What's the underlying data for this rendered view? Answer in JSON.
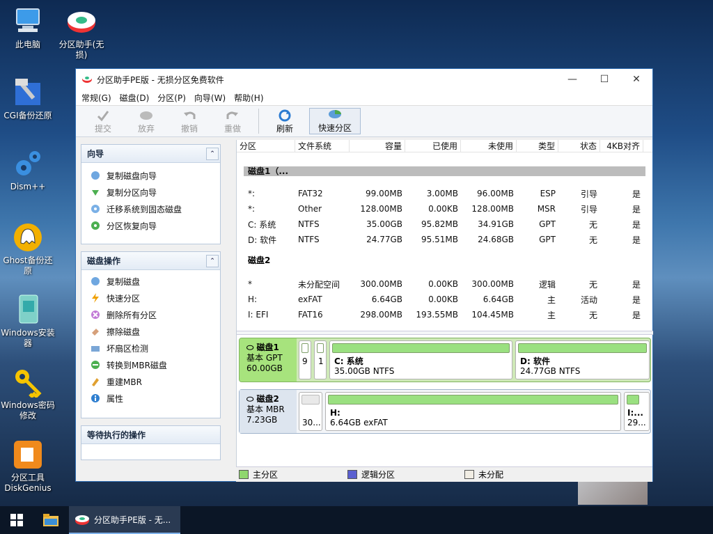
{
  "desktop": {
    "icons": [
      {
        "label": "此电脑"
      },
      {
        "label": "分区助手(无损)"
      },
      {
        "label": "CGI备份还原"
      },
      {
        "label": "Dism++"
      },
      {
        "label": "Ghost备份还原"
      },
      {
        "label": "Windows安装器"
      },
      {
        "label": "Windows密码修改"
      },
      {
        "label": "分区工具DiskGenius"
      }
    ]
  },
  "taskbar": {
    "task_label": "分区助手PE版 - 无..."
  },
  "window": {
    "title": "分区助手PE版 - 无损分区免费软件",
    "minimize": "—",
    "maximize": "☐",
    "close": "✕",
    "menu": [
      "常规(G)",
      "磁盘(D)",
      "分区(P)",
      "向导(W)",
      "帮助(H)"
    ],
    "toolbar": {
      "commit": "提交",
      "discard": "放弃",
      "undo": "撤销",
      "redo": "重做",
      "refresh": "刷新",
      "quick_partition": "快速分区"
    }
  },
  "sidebar": {
    "wizard_title": "向导",
    "wizard_items": [
      "复制磁盘向导",
      "复制分区向导",
      "迁移系统到固态磁盘",
      "分区恢复向导"
    ],
    "diskops_title": "磁盘操作",
    "diskops_items": [
      "复制磁盘",
      "快速分区",
      "删除所有分区",
      "擦除磁盘",
      "坏扇区检测",
      "转换到MBR磁盘",
      "重建MBR",
      "属性"
    ],
    "pending_title": "等待执行的操作"
  },
  "table": {
    "columns": [
      "分区",
      "文件系统",
      "容量",
      "已使用",
      "未使用",
      "类型",
      "状态",
      "4KB对齐"
    ],
    "disk1_label": "磁盘1（...",
    "disk1_rows": [
      {
        "part": "*:",
        "fs": "FAT32",
        "size": "99.00MB",
        "used": "3.00MB",
        "free": "96.00MB",
        "type": "ESP",
        "status": "引导",
        "align": "是"
      },
      {
        "part": "*:",
        "fs": "Other",
        "size": "128.00MB",
        "used": "0.00KB",
        "free": "128.00MB",
        "type": "MSR",
        "status": "引导",
        "align": "是"
      },
      {
        "part": "C: 系统",
        "fs": "NTFS",
        "size": "35.00GB",
        "used": "95.82MB",
        "free": "34.91GB",
        "type": "GPT",
        "status": "无",
        "align": "是"
      },
      {
        "part": "D: 软件",
        "fs": "NTFS",
        "size": "24.77GB",
        "used": "95.51MB",
        "free": "24.68GB",
        "type": "GPT",
        "status": "无",
        "align": "是"
      }
    ],
    "disk2_label": "磁盘2",
    "disk2_rows": [
      {
        "part": "*",
        "fs": "未分配空间",
        "size": "300.00MB",
        "used": "0.00KB",
        "free": "300.00MB",
        "type": "逻辑",
        "status": "无",
        "align": "是"
      },
      {
        "part": "H:",
        "fs": "exFAT",
        "size": "6.64GB",
        "used": "0.00KB",
        "free": "6.64GB",
        "type": "主",
        "status": "活动",
        "align": "是"
      },
      {
        "part": "I: EFI",
        "fs": "FAT16",
        "size": "298.00MB",
        "used": "193.55MB",
        "free": "104.45MB",
        "type": "主",
        "status": "无",
        "align": "是"
      }
    ]
  },
  "diskmap": {
    "disk1": {
      "name": "磁盘1",
      "style": "基本 GPT",
      "size": "60.00GB",
      "seg1": "9",
      "seg2": "1",
      "c_name": "C: 系统",
      "c_info": "35.00GB NTFS",
      "d_name": "D: 软件",
      "d_info": "24.77GB NTFS"
    },
    "disk2": {
      "name": "磁盘2",
      "style": "基本 MBR",
      "size": "7.23GB",
      "seg1": "30...",
      "h_name": "H:",
      "h_info": "6.64GB exFAT",
      "i_name": "I:...",
      "i_info": "29..."
    }
  },
  "legend": {
    "primary": "主分区",
    "logical": "逻辑分区",
    "unallocated": "未分配",
    "colors": {
      "primary": "#8fd66e",
      "logical": "#5a5fd0",
      "unallocated": "#f1ede4"
    }
  }
}
